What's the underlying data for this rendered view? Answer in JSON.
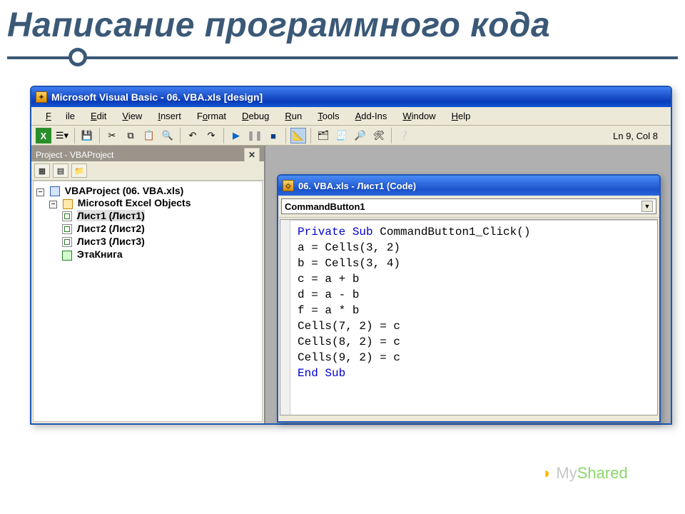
{
  "slide": {
    "title": "Написание программного кода"
  },
  "vbe": {
    "title": "Microsoft Visual Basic - 06. VBA.xls [design]",
    "menu": [
      "File",
      "Edit",
      "View",
      "Insert",
      "Format",
      "Debug",
      "Run",
      "Tools",
      "Add-Ins",
      "Window",
      "Help"
    ],
    "status_position": "Ln 9, Col 8",
    "project_panel": {
      "title": "Project - VBAProject",
      "root": {
        "label": "VBAProject (06. VBA.xls)"
      },
      "group": {
        "label": "Microsoft Excel Objects"
      },
      "nodes": [
        {
          "label": "Лист1 (Лист1)",
          "kind": "sheet",
          "selected": true
        },
        {
          "label": "Лист2 (Лист2)",
          "kind": "sheet"
        },
        {
          "label": "Лист3 (Лист3)",
          "kind": "sheet"
        },
        {
          "label": "ЭтаКнига",
          "kind": "book"
        }
      ]
    },
    "code_window": {
      "title": "06. VBA.xls - Лист1 (Code)",
      "object_dropdown": "CommandButton1",
      "code_lines": [
        {
          "t": "Private Sub ",
          "kw": true,
          "rest": "CommandButton1_Click()"
        },
        {
          "t": "a = Cells(3, 2)"
        },
        {
          "t": "b = Cells(3, 4)"
        },
        {
          "t": "c = a + b"
        },
        {
          "t": "d = a - b"
        },
        {
          "t": "f = a * b"
        },
        {
          "t": "Cells(7, 2) = c"
        },
        {
          "t": "Cells(8, 2) = c"
        },
        {
          "t": "Cells(9, 2) = c"
        },
        {
          "t": "End Sub",
          "kw": true
        }
      ]
    }
  },
  "watermark": "MyShared"
}
